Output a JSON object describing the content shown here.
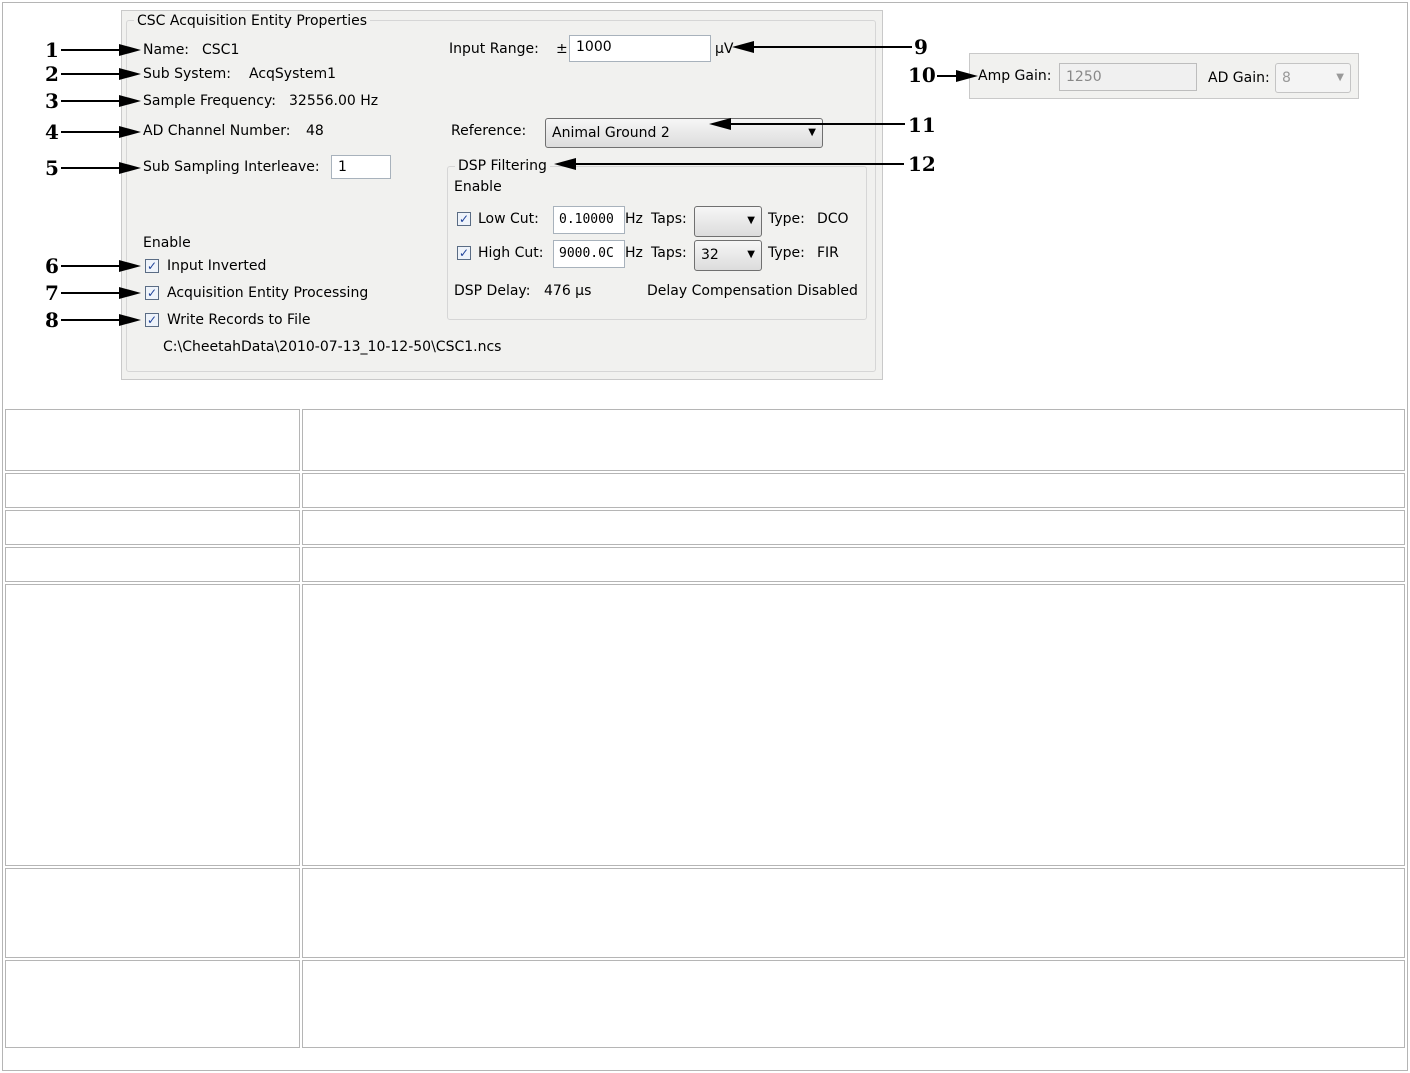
{
  "panel": {
    "title": "CSC Acquisition Entity Properties",
    "name_label": "Name:",
    "name_value": "CSC1",
    "subsystem_label": "Sub System:",
    "subsystem_value": "AcqSystem1",
    "sample_freq_label": "Sample Frequency:",
    "sample_freq_value": "32556.00 Hz",
    "ad_channel_label": "AD Channel Number:",
    "ad_channel_value": "48",
    "sub_sampling_label": "Sub Sampling Interleave:",
    "sub_sampling_value": "1",
    "enable_label": "Enable",
    "input_inverted_label": "Input Inverted",
    "input_inverted_checked": true,
    "acq_processing_label": "Acquisition Entity Processing",
    "acq_processing_checked": true,
    "write_records_label": "Write Records to File",
    "write_records_checked": true,
    "file_path": "C:\\CheetahData\\2010-07-13_10-12-50\\CSC1.ncs",
    "input_range_label": "Input Range:",
    "input_range_pm": "±",
    "input_range_value": "1000",
    "input_range_unit": "µV",
    "reference_label": "Reference:",
    "reference_value": "Animal Ground 2"
  },
  "dsp": {
    "title": "DSP Filtering",
    "enable_label": "Enable",
    "low_cut_label": "Low Cut:",
    "low_cut_value": "0.10000",
    "low_cut_checked": true,
    "high_cut_label": "High Cut:",
    "high_cut_value": "9000.0C",
    "high_cut_checked": true,
    "hz": "Hz",
    "taps_label": "Taps:",
    "low_taps_value": "",
    "high_taps_value": "32",
    "type_label": "Type:",
    "low_type": "DCO",
    "high_type": "FIR",
    "delay_label": "DSP Delay:",
    "delay_value": "476 µs",
    "delay_comp": "Delay Compensation Disabled"
  },
  "gain": {
    "amp_gain_label": "Amp Gain:",
    "amp_gain_value": "1250",
    "ad_gain_label": "AD Gain:",
    "ad_gain_value": "8"
  },
  "callouts": [
    "1",
    "2",
    "3",
    "4",
    "5",
    "6",
    "7",
    "8",
    "9",
    "10",
    "11",
    "12"
  ],
  "table_rows": 7,
  "colors": {
    "panel_bg": "#f1f1ef",
    "border": "#b5b5b5",
    "check": "#21449a"
  }
}
